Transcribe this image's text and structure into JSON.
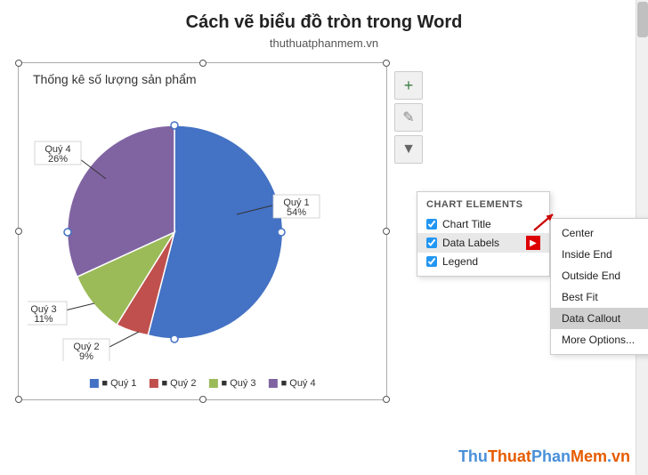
{
  "header": {
    "title": "Cách vẽ biểu đồ tròn trong Word",
    "subtitle": "thuthuatphanmem.vn"
  },
  "chart": {
    "title": "Thống kê số lượng sản phẩm",
    "segments": [
      {
        "label": "Quý 1",
        "percent": 54,
        "color": "#4472C4",
        "startAngle": -90,
        "sweep": 194
      },
      {
        "label": "Quý 2",
        "percent": 9,
        "color": "#C0504D",
        "startAngle": 104,
        "sweep": 32
      },
      {
        "label": "Quý 3",
        "percent": 11,
        "color": "#9BBB59",
        "startAngle": 136,
        "sweep": 40
      },
      {
        "label": "Quý 4",
        "percent": 26,
        "color": "#8064A2",
        "startAngle": 176,
        "sweep": 94
      }
    ],
    "legend": [
      {
        "label": "Quý 1",
        "color": "#4472C4"
      },
      {
        "label": "Quý 2",
        "color": "#C0504D"
      },
      {
        "label": "Quý 3",
        "color": "#9BBB59"
      },
      {
        "label": "Quý 4",
        "color": "#8064A2"
      }
    ]
  },
  "chart_elements_panel": {
    "header": "CHART ELEMENTS",
    "items": [
      {
        "label": "Chart Title",
        "checked": true,
        "has_arrow": false
      },
      {
        "label": "Data Labels",
        "checked": true,
        "has_arrow": true
      },
      {
        "label": "Legend",
        "checked": true,
        "has_arrow": false
      }
    ]
  },
  "submenu": {
    "items": [
      {
        "label": "Center",
        "selected": false
      },
      {
        "label": "Inside End",
        "selected": false
      },
      {
        "label": "Outside End",
        "selected": false
      },
      {
        "label": "Best Fit",
        "selected": false
      },
      {
        "label": "Data Callout",
        "selected": true
      },
      {
        "label": "More Options...",
        "selected": false
      }
    ]
  },
  "buttons": {
    "plus": "+",
    "brush": "✎",
    "filter": "⊞"
  },
  "watermark": {
    "text": "ThuThuatPhanMem.vn"
  }
}
